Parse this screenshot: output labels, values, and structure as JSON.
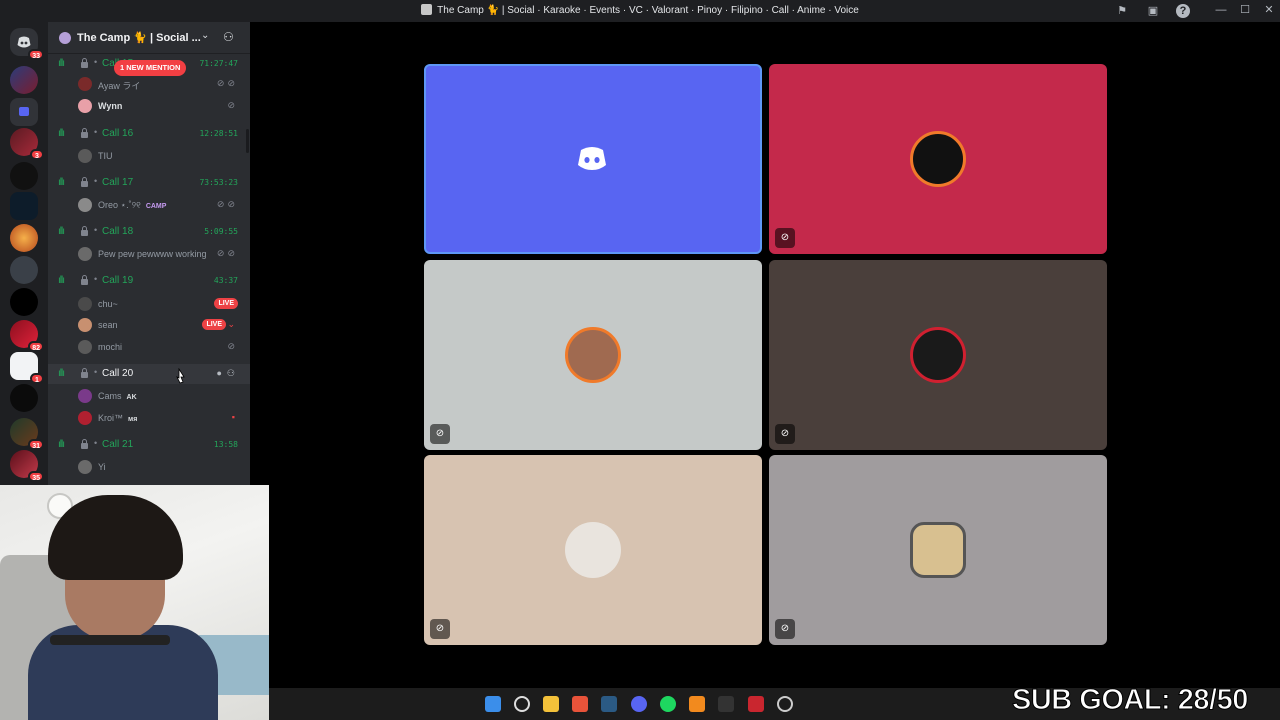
{
  "window": {
    "title": "The Camp 🐈 | Social · Karaoke · Events · VC · Valorant · Pinoy · Filipino · Call · Anime · Voice"
  },
  "rail": {
    "badges": [
      "33",
      "3",
      "82",
      "1",
      "31",
      "35"
    ]
  },
  "guild": {
    "name": "The Camp 🐈 | Social ...",
    "mention_pill": "1 NEW MENTION"
  },
  "channels": [
    {
      "name": "Call 15",
      "timer": "71:27:47",
      "members": [
        {
          "name": "Ayaw ライ"
        },
        {
          "name": "Wynn"
        }
      ]
    },
    {
      "name": "Call 16",
      "timer": "12:28:51",
      "members": [
        {
          "name": "TIU"
        }
      ]
    },
    {
      "name": "Call 17",
      "timer": "73:53:23",
      "members": [
        {
          "name": "Oreo ⋆.˚୨୧",
          "tag": "CAMP"
        }
      ]
    },
    {
      "name": "Call 18",
      "timer": "5:09:55",
      "members": [
        {
          "name": "Pew pew pewwww working"
        }
      ]
    },
    {
      "name": "Call 19",
      "timer": "43:37",
      "members": [
        {
          "name": "chu~",
          "live": "LIVE"
        },
        {
          "name": "sean",
          "live": "LIVE"
        },
        {
          "name": "mochi"
        }
      ]
    },
    {
      "name": "Call 20",
      "timer": "",
      "members": [
        {
          "name": "Cams",
          "tag": "AK"
        },
        {
          "name": "Kroi™",
          "tag": "мя"
        }
      ]
    },
    {
      "name": "Call 21",
      "timer": "13:58",
      "members": [
        {
          "name": "Yi"
        }
      ]
    }
  ],
  "overlay": {
    "sub_goal": "SUB GOAL: 28/50"
  },
  "colors": {
    "blurple": "#5865f2",
    "voice_green": "#23a55a",
    "live_red": "#ed4245",
    "tile_red": "#c4294b",
    "tile_gray": "#c5c9c8",
    "tile_brown": "#4a3f3b",
    "tile_beige": "#d7c3b1",
    "tile_mauve": "#a09c9e"
  }
}
